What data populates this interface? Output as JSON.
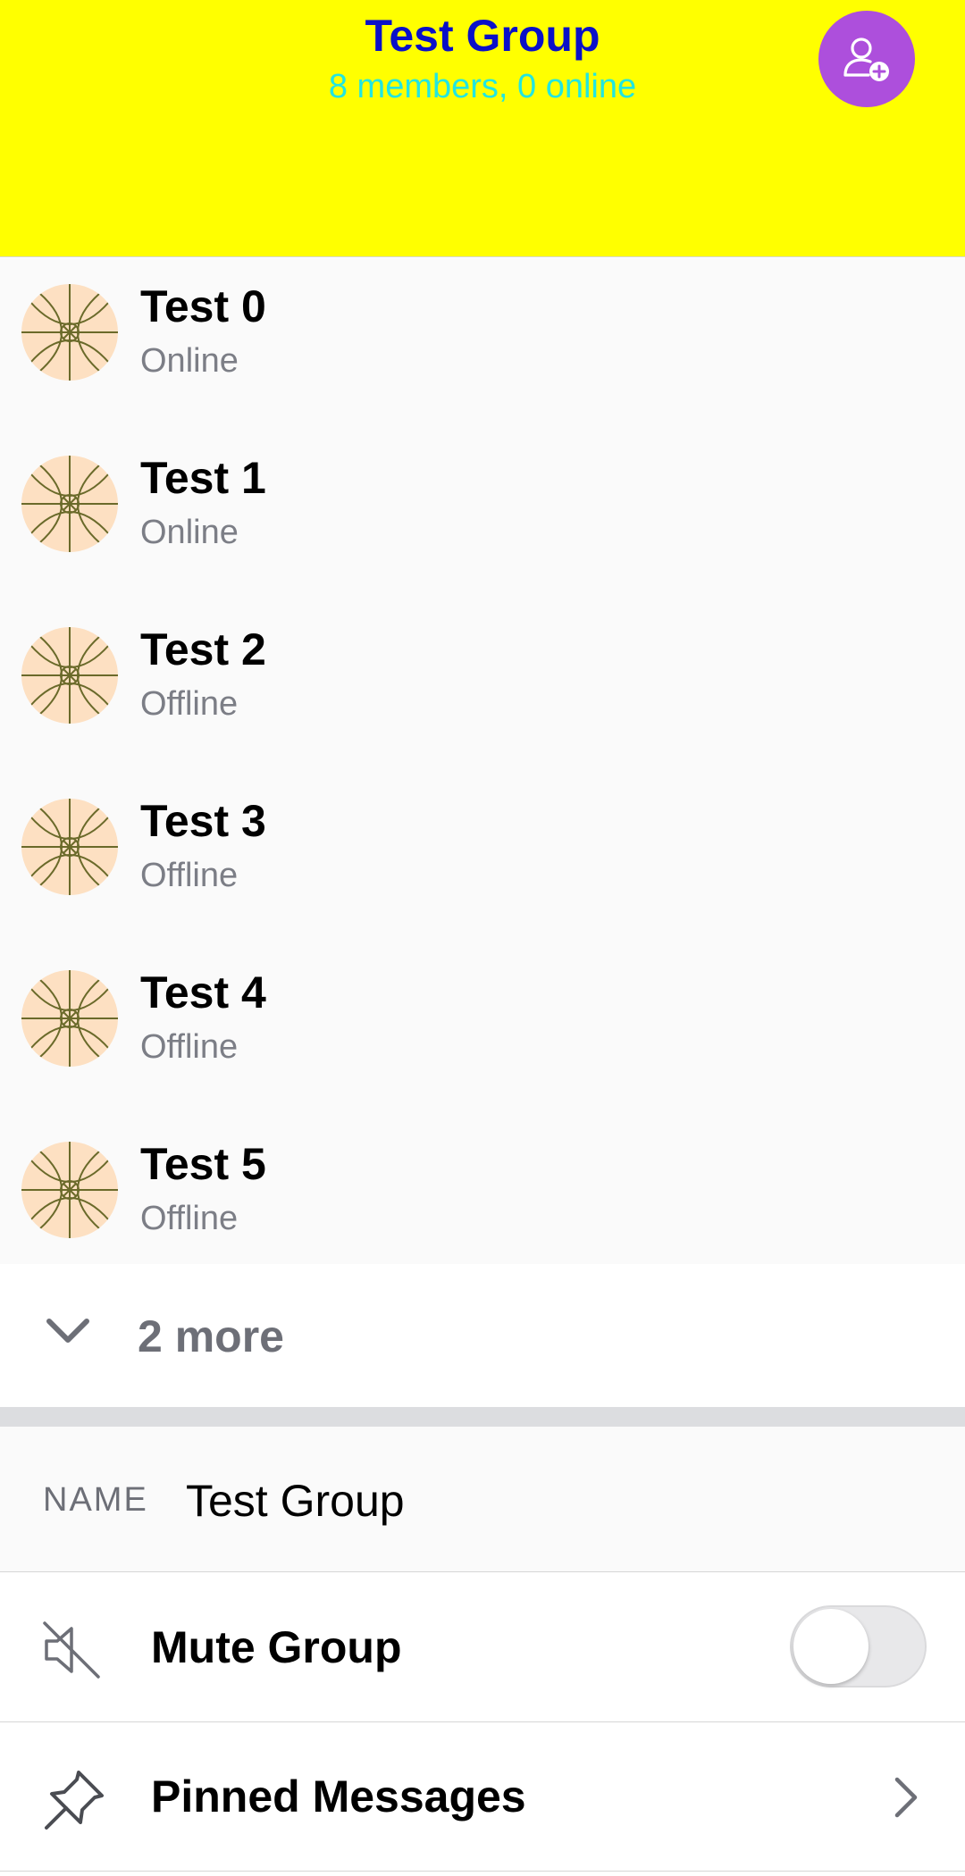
{
  "header": {
    "title": "Test Group",
    "subtitle": "8 members, 0 online",
    "add_member_icon": "add-user-icon",
    "background": "#ffff00",
    "title_color": "#0a10c8",
    "subtitle_color": "#22e6e0",
    "button_color": "#ad4fdc"
  },
  "members": [
    {
      "name": "Test 0",
      "status": "Online"
    },
    {
      "name": "Test 1",
      "status": "Online"
    },
    {
      "name": "Test 2",
      "status": "Offline"
    },
    {
      "name": "Test 3",
      "status": "Offline"
    },
    {
      "name": "Test 4",
      "status": "Offline"
    },
    {
      "name": "Test 5",
      "status": "Offline"
    }
  ],
  "more": {
    "label": "2 more",
    "icon": "chevron-down-icon"
  },
  "name_field": {
    "label": "NAME",
    "value": "Test Group"
  },
  "settings": {
    "mute": {
      "label": "Mute Group",
      "icon": "mute-icon",
      "enabled": false
    },
    "pinned": {
      "label": "Pinned Messages",
      "icon": "pin-icon",
      "chevron": "chevron-right-icon"
    }
  }
}
